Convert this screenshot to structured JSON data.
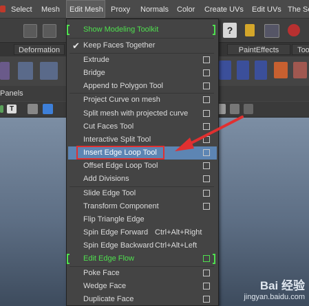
{
  "menubar": {
    "items": [
      "Select",
      "Mesh",
      "Edit Mesh",
      "Proxy",
      "Normals",
      "Color",
      "Create UVs",
      "Edit UVs",
      "The Se"
    ],
    "active": "Edit Mesh"
  },
  "shelf_tabs": [
    "Deformation",
    "PaintEffects",
    "Toon"
  ],
  "panels_label": "Panels",
  "menu": {
    "items": [
      {
        "label": "Show Modeling Toolkit",
        "style": "green-bracket"
      },
      {
        "label": "Keep Faces Together",
        "checked": true
      },
      {
        "label": "Extrude",
        "option_box": true
      },
      {
        "label": "Bridge",
        "option_box": true
      },
      {
        "label": "Append to Polygon Tool",
        "option_box": true
      },
      {
        "label": "Project Curve on mesh",
        "option_box": true
      },
      {
        "label": "Split mesh with projected curve",
        "option_box": true
      },
      {
        "label": "Cut Faces Tool",
        "option_box": true
      },
      {
        "label": "Interactive Split Tool",
        "option_box": true
      },
      {
        "label": "Insert Edge Loop Tool",
        "option_box": true,
        "highlighted": true
      },
      {
        "label": "Offset Edge Loop Tool",
        "option_box": true
      },
      {
        "label": "Add Divisions",
        "option_box": true
      },
      {
        "label": "Slide Edge Tool",
        "option_box": true
      },
      {
        "label": "Transform Component",
        "option_box": true
      },
      {
        "label": "Flip Triangle Edge"
      },
      {
        "label": "Spin Edge Forward",
        "shortcut": "Ctrl+Alt+Right"
      },
      {
        "label": "Spin Edge Backward",
        "shortcut": "Ctrl+Alt+Left"
      },
      {
        "label": "Edit Edge Flow",
        "style": "green-bracket",
        "option_box": true
      },
      {
        "label": "Poke Face",
        "option_box": true
      },
      {
        "label": "Wedge Face",
        "option_box": true
      },
      {
        "label": "Duplicate Face",
        "option_box": true
      }
    ]
  },
  "annotation": {
    "color": "#e03030"
  },
  "watermark": {
    "logo": "Bai 经验",
    "url": "jingyan.baidu.com"
  },
  "colors": {
    "accent_green": "#4fe04f",
    "highlight": "#5d85b3"
  }
}
